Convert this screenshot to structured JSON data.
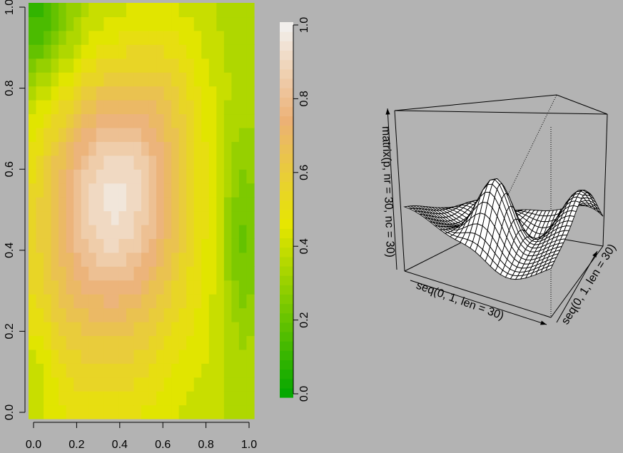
{
  "chart_data": [
    {
      "type": "heatmap",
      "title": "",
      "xlabel": "",
      "ylabel": "",
      "xlim": [
        0,
        1
      ],
      "ylim": [
        0,
        1
      ],
      "x_ticks": [
        "0.0",
        "0.2",
        "0.4",
        "0.6",
        "0.8",
        "1.0"
      ],
      "y_ticks": [
        "0.0",
        "0.2",
        "0.4",
        "0.6",
        "0.8",
        "1.0"
      ],
      "grid_size": [
        30,
        30
      ],
      "surface_description": "smooth field: broad peak near x=0.35, y=0.58; low values in the upper-left corner and along the right edge around x=0.95",
      "colorbar": {
        "range": [
          0,
          1
        ],
        "ticks": [
          "0.0",
          "0.2",
          "0.4",
          "0.6",
          "0.8",
          "1.0"
        ],
        "palette": "terrain",
        "colors": [
          "#00A600",
          "#E6E600",
          "#ECB176",
          "#F2F2F2"
        ]
      }
    },
    {
      "type": "surface3d",
      "style": "wireframe perspective",
      "xlabel": "seq(0, 1, len = 30)",
      "ylabel": "seq(0, 1, len = 30)",
      "zlabel": "matrix(p, nr = 30, nc = 30)",
      "grid_size": [
        30,
        30
      ],
      "box": true,
      "axes": "no tick marks, axis arrows with labels"
    }
  ],
  "colors": {
    "background": "#b3b3b3",
    "wire": "#000000",
    "facet": "#ffffff"
  }
}
